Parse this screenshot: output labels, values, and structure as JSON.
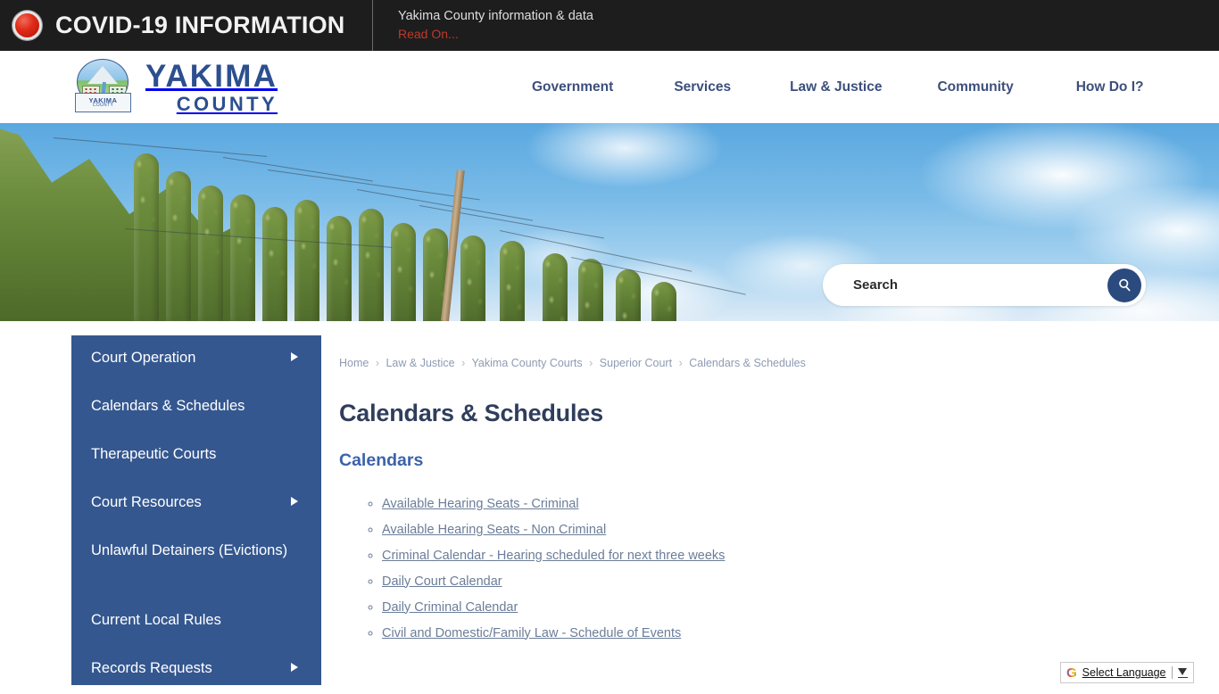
{
  "alert": {
    "icon": "red-alert-dot",
    "title": "COVID-19 INFORMATION",
    "subtitle": "Yakima County information & data",
    "read_on": "Read On..."
  },
  "header": {
    "logo": {
      "emblem_alt": "yakima-county-seal",
      "seal_word_main": "YAKIMA",
      "seal_word_sub": "COUNTY",
      "word_main": "YAKIMA",
      "word_sub": "COUNTY",
      "brand_color": "#2c4f8f"
    },
    "nav": [
      {
        "label": "Government"
      },
      {
        "label": "Services"
      },
      {
        "label": "Law & Justice"
      },
      {
        "label": "Community"
      },
      {
        "label": "How Do I?"
      }
    ]
  },
  "hero": {
    "image_alt": "hop-field-and-sky-banner",
    "search": {
      "placeholder": "Search",
      "value": "",
      "button_icon": "search-icon",
      "button_color": "#2b4b7e"
    }
  },
  "sidebar": {
    "background": "#34578f",
    "items": [
      {
        "label": "Court Operation",
        "has_submenu": true,
        "tall": false
      },
      {
        "label": "Calendars & Schedules",
        "has_submenu": false,
        "tall": false
      },
      {
        "label": "Therapeutic Courts",
        "has_submenu": false,
        "tall": false
      },
      {
        "label": "Court Resources",
        "has_submenu": true,
        "tall": false
      },
      {
        "label": "Unlawful Detainers (Evictions)",
        "has_submenu": false,
        "tall": true
      },
      {
        "label": "Current Local Rules",
        "has_submenu": false,
        "tall": false
      },
      {
        "label": "Records Requests",
        "has_submenu": true,
        "tall": false
      }
    ]
  },
  "main": {
    "breadcrumb": [
      "Home",
      "Law & Justice",
      "Yakima County Courts",
      "Superior Court",
      "Calendars & Schedules"
    ],
    "breadcrumb_separator": "›",
    "page_title": "Calendars & Schedules",
    "section_title": "Calendars",
    "links": [
      {
        "label": "Available Hearing Seats - Criminal"
      },
      {
        "label": "Available Hearing Seats - Non Criminal"
      },
      {
        "label": "Criminal Calendar - Hearing scheduled for next three weeks"
      },
      {
        "label": "Daily Court Calendar"
      },
      {
        "label": "Daily Criminal Calendar"
      },
      {
        "label": "Civil and Domestic/Family Law - Schedule of Events"
      }
    ]
  },
  "translate_widget": {
    "logo": "G",
    "label": "Select Language",
    "caret_icon": "chevron-down-icon"
  }
}
